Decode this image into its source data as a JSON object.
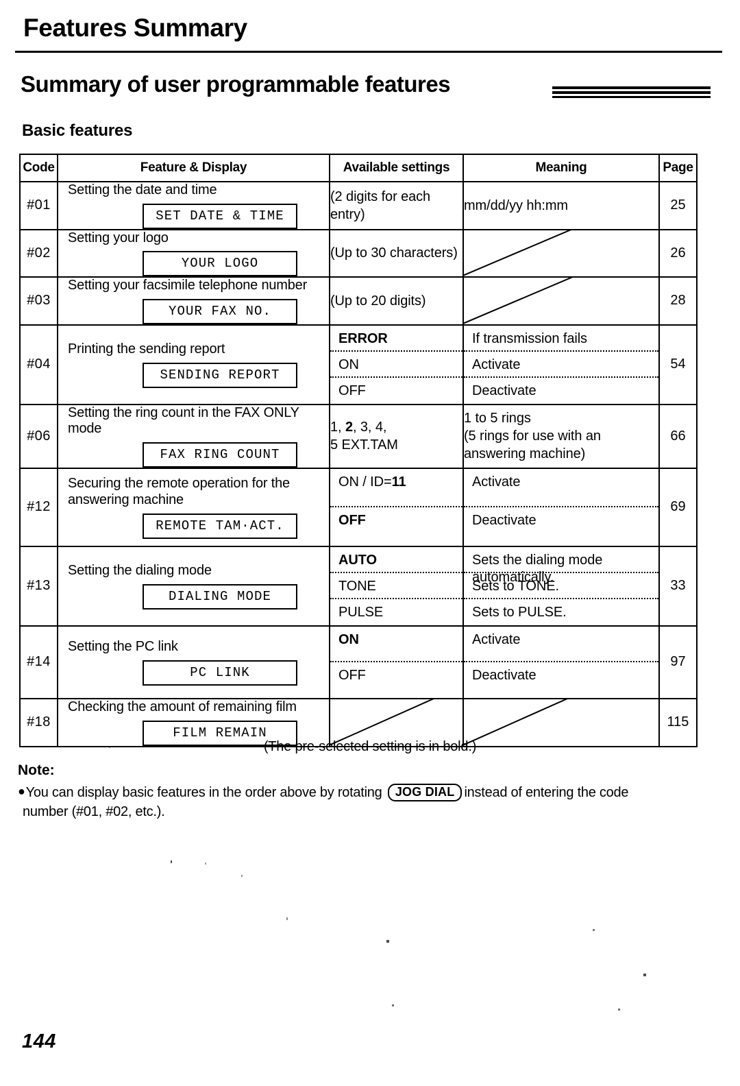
{
  "header": {
    "chapter_title": "Features Summary",
    "section_title": "Summary of user programmable features",
    "subsection_title": "Basic features"
  },
  "table": {
    "columns": [
      "Code",
      "Feature & Display",
      "Available settings",
      "Meaning",
      "Page"
    ],
    "rows": [
      {
        "code": "#01",
        "feature": "Setting the date and time",
        "display": "SET DATE & TIME",
        "available": "(2 digits for each entry)",
        "meaning": "mm/dd/yy  hh:mm",
        "page": "25"
      },
      {
        "code": "#02",
        "feature": "Setting your logo",
        "display": "YOUR LOGO",
        "available": "(Up to 30 characters)",
        "meaning": "",
        "page": "26"
      },
      {
        "code": "#03",
        "feature": "Setting your facsimile telephone number",
        "display": "YOUR FAX NO.",
        "available": "(Up to 20 digits)",
        "meaning": "",
        "page": "28"
      },
      {
        "code": "#04",
        "feature": "Printing the sending report",
        "display": "SENDING REPORT",
        "settings": [
          {
            "value": "ERROR",
            "bold": true,
            "meaning": "If transmission fails"
          },
          {
            "value": "ON",
            "bold": false,
            "meaning": "Activate"
          },
          {
            "value": "OFF",
            "bold": false,
            "meaning": "Deactivate"
          }
        ],
        "page": "54"
      },
      {
        "code": "#06",
        "feature": "Setting the ring count in the FAX ONLY mode",
        "display": "FAX RING COUNT",
        "available_line1_a": "1, ",
        "available_line1_bold": "2",
        "available_line1_b": ", 3, 4,",
        "available_line2": "5 EXT.TAM",
        "meaning_line1": "1 to 5 rings",
        "meaning_line2": "(5 rings for use with an",
        "meaning_line3": "answering machine)",
        "page": "66"
      },
      {
        "code": "#12",
        "feature": "Securing the remote operation for the answering machine",
        "display": "REMOTE TAM·ACT.",
        "settings": [
          {
            "value_a": "ON / ID=",
            "value_bold": "11",
            "bold": false,
            "meaning": "Activate"
          },
          {
            "value": "OFF",
            "bold": true,
            "meaning": "Deactivate"
          }
        ],
        "page": "69"
      },
      {
        "code": "#13",
        "feature": "Setting the dialing mode",
        "display": "DIALING MODE",
        "settings": [
          {
            "value": "AUTO",
            "bold": true,
            "meaning": "Sets the dialing mode automatically.",
            "small": true
          },
          {
            "value": "TONE",
            "bold": false,
            "meaning": "Sets to TONE."
          },
          {
            "value": "PULSE",
            "bold": false,
            "meaning": "Sets to PULSE."
          }
        ],
        "page": "33"
      },
      {
        "code": "#14",
        "feature": "Setting the PC link",
        "display": "PC LINK",
        "settings": [
          {
            "value": "ON",
            "bold": true,
            "meaning": "Activate"
          },
          {
            "value": "OFF",
            "bold": false,
            "meaning": "Deactivate"
          }
        ],
        "page": "97"
      },
      {
        "code": "#18",
        "feature": "Checking the amount of remaining film",
        "display": "FILM REMAIN",
        "available": "",
        "meaning": "",
        "page": "115"
      }
    ]
  },
  "footer": {
    "preselected_note": "(The pre-selected setting is in bold.)",
    "note_heading": "Note:",
    "note_text_before": "You can display basic features in the order above by rotating",
    "note_button": "JOG DIAL",
    "note_text_after": "instead of entering the code",
    "note_text_line2": "number (#01, #02, etc.).",
    "page_number": "144"
  }
}
